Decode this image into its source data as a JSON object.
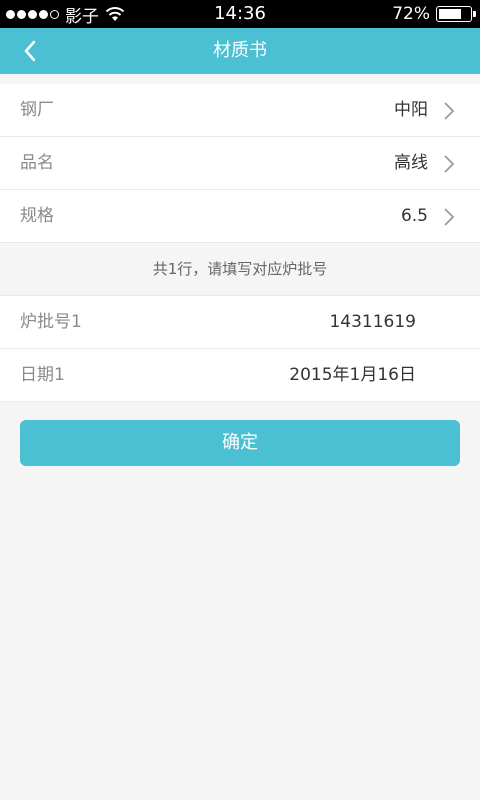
{
  "status_bar": {
    "carrier": "影子",
    "time": "14:36",
    "battery_percent": "72%",
    "battery_level": 0.72
  },
  "nav": {
    "title": "材质书"
  },
  "rows": [
    {
      "label": "钢厂",
      "value": "中阳"
    },
    {
      "label": "品名",
      "value": "高线"
    },
    {
      "label": "规格",
      "value": "6.5"
    }
  ],
  "hint": "共1行，请填写对应炉批号",
  "fields": [
    {
      "label": "炉批号1",
      "value": "14311619"
    },
    {
      "label": "日期1",
      "value": "2015年1月16日"
    }
  ],
  "confirm_label": "确定",
  "colors": {
    "accent": "#4bc0d3"
  }
}
